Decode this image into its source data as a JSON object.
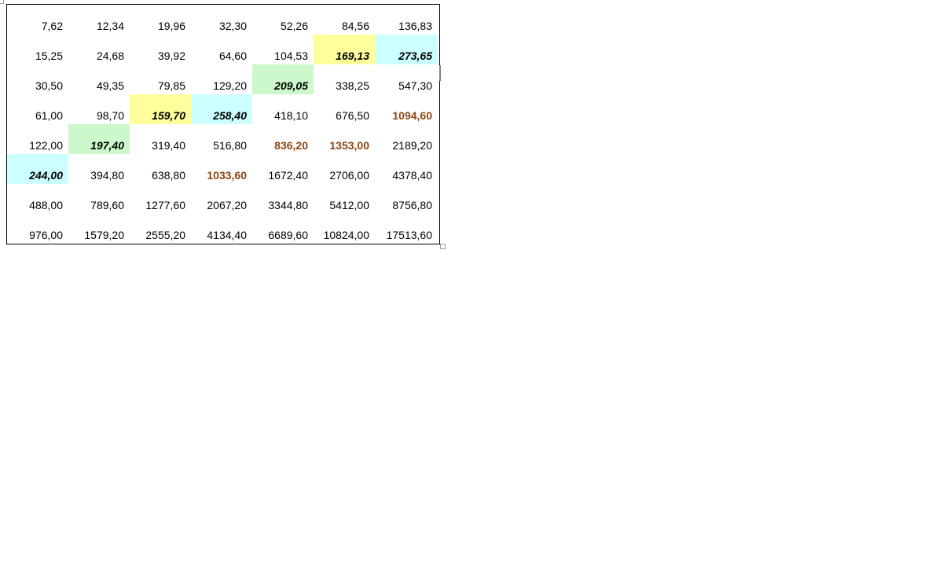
{
  "colors": {
    "yellow": "#ffff9c",
    "green": "#ccf8cc",
    "cyan": "#ccffff",
    "brown": "#8b4513"
  },
  "table": {
    "rows": [
      [
        {
          "v": "7,62"
        },
        {
          "v": "12,34"
        },
        {
          "v": "19,96"
        },
        {
          "v": "32,30"
        },
        {
          "v": "52,26"
        },
        {
          "v": "84,56"
        },
        {
          "v": "136,83"
        }
      ],
      [
        {
          "v": "15,25"
        },
        {
          "v": "24,68"
        },
        {
          "v": "39,92"
        },
        {
          "v": "64,60"
        },
        {
          "v": "104,53"
        },
        {
          "v": "169,13",
          "bg": "yellow",
          "em": true
        },
        {
          "v": "273,65",
          "bg": "cyan",
          "em": true
        }
      ],
      [
        {
          "v": "30,50"
        },
        {
          "v": "49,35"
        },
        {
          "v": "79,85"
        },
        {
          "v": "129,20"
        },
        {
          "v": "209,05",
          "bg": "green",
          "em": true
        },
        {
          "v": "338,25"
        },
        {
          "v": "547,30"
        }
      ],
      [
        {
          "v": "61,00"
        },
        {
          "v": "98,70"
        },
        {
          "v": "159,70",
          "bg": "yellow",
          "em": true
        },
        {
          "v": "258,40",
          "bg": "cyan",
          "em": true
        },
        {
          "v": "418,10"
        },
        {
          "v": "676,50"
        },
        {
          "v": "1094,60",
          "brown": true
        }
      ],
      [
        {
          "v": "122,00"
        },
        {
          "v": "197,40",
          "bg": "green",
          "em": true
        },
        {
          "v": "319,40"
        },
        {
          "v": "516,80"
        },
        {
          "v": "836,20",
          "brown": true
        },
        {
          "v": "1353,00",
          "brown": true
        },
        {
          "v": "2189,20"
        }
      ],
      [
        {
          "v": "244,00",
          "bg": "cyan",
          "em": true
        },
        {
          "v": "394,80"
        },
        {
          "v": "638,80"
        },
        {
          "v": "1033,60",
          "brown": true
        },
        {
          "v": "1672,40"
        },
        {
          "v": "2706,00"
        },
        {
          "v": "4378,40"
        }
      ],
      [
        {
          "v": "488,00"
        },
        {
          "v": "789,60"
        },
        {
          "v": "1277,60"
        },
        {
          "v": "2067,20"
        },
        {
          "v": "3344,80"
        },
        {
          "v": "5412,00"
        },
        {
          "v": "8756,80"
        }
      ],
      [
        {
          "v": "976,00"
        },
        {
          "v": "1579,20"
        },
        {
          "v": "2555,20"
        },
        {
          "v": "4134,40"
        },
        {
          "v": "6689,60"
        },
        {
          "v": "10824,00"
        },
        {
          "v": "17513,60"
        }
      ]
    ]
  }
}
